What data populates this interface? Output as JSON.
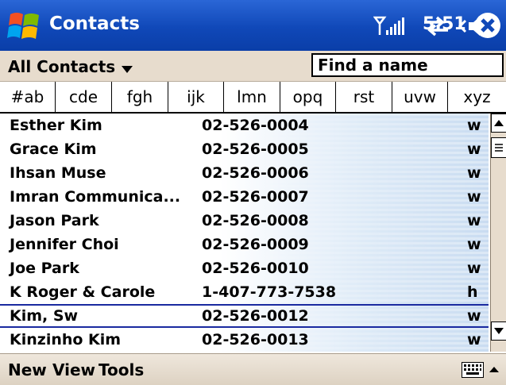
{
  "titlebar": {
    "app_title": "Contacts",
    "time": "5:51",
    "start_icon": "windows-flag-icon",
    "signal_icon": "signal-strength-icon",
    "sync_icon": "connectivity-arrows-icon",
    "volume_icon": "speaker-icon",
    "close_icon": "close-icon"
  },
  "command_row": {
    "category_label": "All Contacts",
    "find_placeholder": "Find a name"
  },
  "tabs": [
    "#ab",
    "cde",
    "fgh",
    "ijk",
    "lmn",
    "opq",
    "rst",
    "uvw",
    "xyz"
  ],
  "contacts": [
    {
      "name": "Esther Kim",
      "phone": "02-526-0004",
      "type": "w"
    },
    {
      "name": "Grace Kim",
      "phone": "02-526-0005",
      "type": "w"
    },
    {
      "name": "Ihsan Muse",
      "phone": "02-526-0006",
      "type": "w"
    },
    {
      "name": "Imran Communica...",
      "phone": "02-526-0007",
      "type": "w"
    },
    {
      "name": "Jason Park",
      "phone": "02-526-0008",
      "type": "w"
    },
    {
      "name": "Jennifer Choi",
      "phone": "02-526-0009",
      "type": "w"
    },
    {
      "name": "Joe Park",
      "phone": "02-526-0010",
      "type": "w"
    },
    {
      "name": "K Roger & Carole",
      "phone": "1-407-773-7538",
      "type": "h"
    },
    {
      "name": "Kim, Sw",
      "phone": "02-526-0012",
      "type": "w",
      "selected": true
    },
    {
      "name": "Kinzinho Kim",
      "phone": "02-526-0013",
      "type": "w"
    }
  ],
  "menubar": {
    "new_label": "New",
    "view_label": "View",
    "tools_label": "Tools",
    "keyboard_icon": "keyboard-icon",
    "sip_arrow_icon": "chevron-up-icon"
  },
  "colors": {
    "title_bar": "#1048b8",
    "chrome": "#e7dccd",
    "selection_border": "#1a2aa0"
  }
}
